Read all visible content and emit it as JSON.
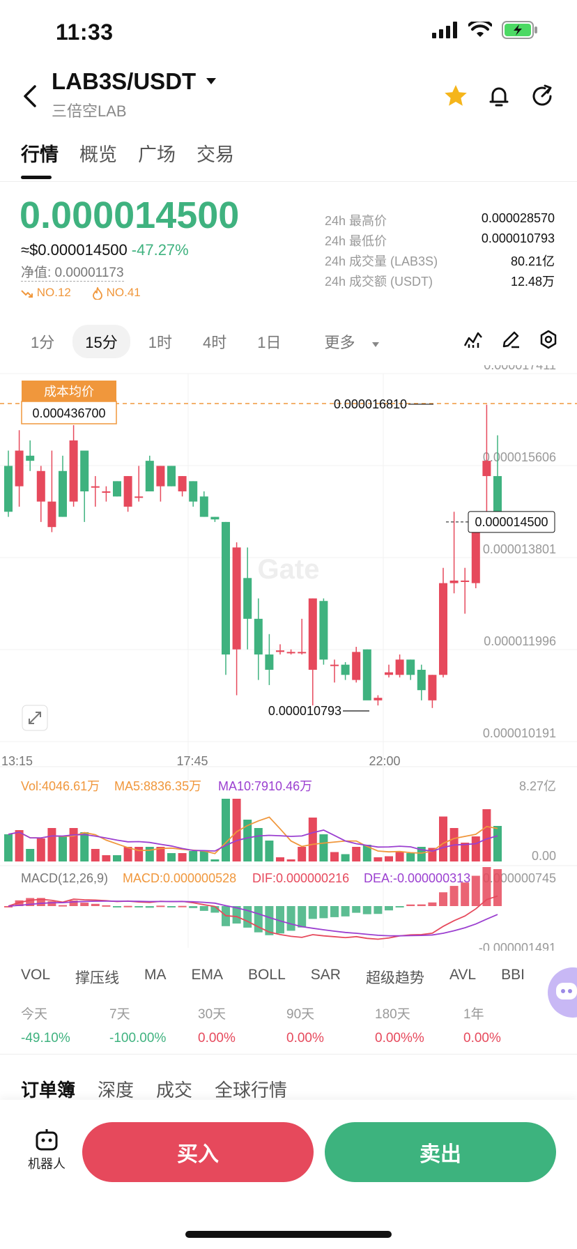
{
  "status_bar": {
    "time": "11:33"
  },
  "header": {
    "pair": "LAB3S/USDT",
    "subtitle": "三倍空LAB"
  },
  "tabs": [
    "行情",
    "概览",
    "广场",
    "交易"
  ],
  "price": {
    "last": "0.000014500",
    "usd": "≈$0.000014500",
    "change": "-47.27%",
    "net_value": "净值: 0.00001173",
    "rank1": "NO.12",
    "rank2": "NO.41"
  },
  "stats": [
    {
      "label": "24h 最高价",
      "value": "0.000028570"
    },
    {
      "label": "24h 最低价",
      "value": "0.000010793"
    },
    {
      "label": "24h 成交量 (LAB3S)",
      "value": "80.21亿"
    },
    {
      "label": "24h 成交额 (USDT)",
      "value": "12.48万"
    }
  ],
  "intervals": [
    "1分",
    "15分",
    "1时",
    "4时",
    "1日",
    "更多"
  ],
  "chart_data": {
    "type": "candlestick",
    "y_axis_labels": [
      "0.000017411",
      "0.000015606",
      "0.000013801",
      "0.000011996",
      "0.000010191"
    ],
    "x_axis_labels": [
      "13:15",
      "17:45",
      "22:00"
    ],
    "cost_label": "成本均价",
    "cost_value": "0.000436700",
    "high_marker": "0.000016810",
    "low_marker": "0.000010793",
    "last_price_tag": "0.000014500",
    "watermark": "Gate",
    "candles": [
      {
        "o": 15.6,
        "h": 15.9,
        "l": 14.6,
        "c": 14.7
      },
      {
        "o": 15.2,
        "h": 16.3,
        "l": 14.8,
        "c": 15.9
      },
      {
        "o": 15.8,
        "h": 16.1,
        "l": 15.5,
        "c": 15.7
      },
      {
        "o": 14.9,
        "h": 15.6,
        "l": 14.5,
        "c": 15.5
      },
      {
        "o": 14.4,
        "h": 15.9,
        "l": 14.3,
        "c": 14.9
      },
      {
        "o": 15.5,
        "h": 15.8,
        "l": 14.6,
        "c": 14.6
      },
      {
        "o": 14.9,
        "h": 16.4,
        "l": 14.8,
        "c": 16.1
      },
      {
        "o": 15.9,
        "h": 15.9,
        "l": 14.5,
        "c": 15.1
      },
      {
        "o": 15.2,
        "h": 15.4,
        "l": 14.8,
        "c": 15.2
      },
      {
        "o": 15.1,
        "h": 15.2,
        "l": 14.9,
        "c": 15.1
      },
      {
        "o": 15.3,
        "h": 15.3,
        "l": 15.0,
        "c": 15.0
      },
      {
        "o": 14.8,
        "h": 15.4,
        "l": 14.7,
        "c": 15.4
      },
      {
        "o": 15.0,
        "h": 15.6,
        "l": 14.9,
        "c": 15.0
      },
      {
        "o": 15.7,
        "h": 15.8,
        "l": 15.1,
        "c": 15.1
      },
      {
        "o": 15.2,
        "h": 15.6,
        "l": 14.9,
        "c": 15.6
      },
      {
        "o": 15.6,
        "h": 15.6,
        "l": 15.2,
        "c": 15.2
      },
      {
        "o": 15.1,
        "h": 15.4,
        "l": 15.0,
        "c": 15.4
      },
      {
        "o": 15.3,
        "h": 15.3,
        "l": 14.8,
        "c": 14.9
      },
      {
        "o": 15.0,
        "h": 15.1,
        "l": 14.6,
        "c": 14.6
      },
      {
        "o": 14.6,
        "h": 14.6,
        "l": 14.5,
        "c": 14.55
      },
      {
        "o": 14.5,
        "h": 14.5,
        "l": 11.5,
        "c": 11.9
      },
      {
        "o": 12.0,
        "h": 14.1,
        "l": 11.1,
        "c": 14.0
      },
      {
        "o": 13.4,
        "h": 14.0,
        "l": 12.0,
        "c": 12.6
      },
      {
        "o": 12.6,
        "h": 13.0,
        "l": 11.4,
        "c": 11.9
      },
      {
        "o": 11.9,
        "h": 12.3,
        "l": 11.3,
        "c": 11.6
      },
      {
        "o": 11.95,
        "h": 12.1,
        "l": 11.9,
        "c": 11.98
      },
      {
        "o": 11.95,
        "h": 12.0,
        "l": 11.9,
        "c": 11.95
      },
      {
        "o": 11.95,
        "h": 12.6,
        "l": 11.9,
        "c": 11.95
      },
      {
        "o": 11.6,
        "h": 13.0,
        "l": 10.9,
        "c": 13.0
      },
      {
        "o": 12.95,
        "h": 13.0,
        "l": 11.7,
        "c": 11.8
      },
      {
        "o": 11.7,
        "h": 11.8,
        "l": 11.35,
        "c": 11.7
      },
      {
        "o": 11.7,
        "h": 11.75,
        "l": 11.4,
        "c": 11.5
      },
      {
        "o": 11.4,
        "h": 12.05,
        "l": 11.35,
        "c": 11.95
      },
      {
        "o": 12.0,
        "h": 12.0,
        "l": 11.2,
        "c": 11.0
      },
      {
        "o": 11.0,
        "h": 11.1,
        "l": 10.9,
        "c": 11.05
      },
      {
        "o": 11.5,
        "h": 11.7,
        "l": 11.45,
        "c": 11.55
      },
      {
        "o": 11.5,
        "h": 11.9,
        "l": 11.45,
        "c": 11.8
      },
      {
        "o": 11.8,
        "h": 11.8,
        "l": 11.4,
        "c": 11.5
      },
      {
        "o": 11.6,
        "h": 11.7,
        "l": 11.0,
        "c": 11.2
      },
      {
        "o": 11.0,
        "h": 11.5,
        "l": 10.85,
        "c": 11.5
      },
      {
        "o": 11.5,
        "h": 13.6,
        "l": 11.45,
        "c": 13.3
      },
      {
        "o": 13.3,
        "h": 14.7,
        "l": 13.1,
        "c": 13.35
      },
      {
        "o": 13.35,
        "h": 13.6,
        "l": 12.7,
        "c": 13.35
      },
      {
        "o": 13.3,
        "h": 14.4,
        "l": 13.2,
        "c": 14.5
      },
      {
        "o": 15.4,
        "h": 16.8,
        "l": 14.3,
        "c": 15.7
      },
      {
        "o": 15.4,
        "h": 16.2,
        "l": 14.5,
        "c": 14.5
      }
    ]
  },
  "volume": {
    "vol": "Vol:4046.61万",
    "ma5": "MA5:8836.35万",
    "ma10": "MA10:7910.46万",
    "top": "8.27亿",
    "bottom": "0.00"
  },
  "macd": {
    "params": "MACD(12,26,9)",
    "macd": "MACD:0.000000528",
    "dif": "DIF:0.000000216",
    "dea": "DEA:-0.000000313",
    "top": "0.000000745",
    "bottom": "-0.000001491"
  },
  "indicator_tabs": [
    "VOL",
    "撑压线",
    "MA",
    "EMA",
    "BOLL",
    "SAR",
    "超级趋势",
    "AVL",
    "BBI"
  ],
  "performance": [
    {
      "label": "今天",
      "value": "-49.10%",
      "color": "#3fb27f"
    },
    {
      "label": "7天",
      "value": "-100.00%",
      "color": "#3fb27f"
    },
    {
      "label": "30天",
      "value": "0.00%",
      "color": "#e6495c"
    },
    {
      "label": "90天",
      "value": "0.00%",
      "color": "#e6495c"
    },
    {
      "label": "180天",
      "value": "0.00%%",
      "color": "#e6495c"
    },
    {
      "label": "1年",
      "value": "0.00%",
      "color": "#e6495c"
    }
  ],
  "orderbook_tabs": [
    "订单簿",
    "深度",
    "成交",
    "全球行情"
  ],
  "bottom": {
    "robot": "机器人",
    "buy": "买入",
    "sell": "卖出"
  },
  "colors": {
    "up": "#e6495c",
    "down": "#3fb27f",
    "cost_line": "#f0973c"
  }
}
